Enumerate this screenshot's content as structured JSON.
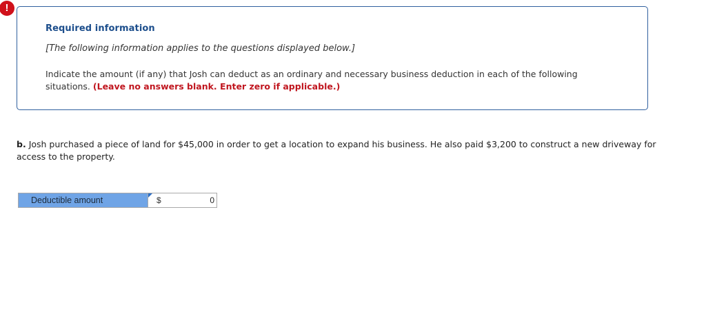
{
  "info_box": {
    "alert_symbol": "!",
    "title": "Required information",
    "note": "[The following information applies to the questions displayed below.]",
    "instructions": "Indicate the amount (if any) that Josh can deduct as an ordinary and necessary business deduction in each of the following situations.",
    "instructions_emphasis": "(Leave no answers blank. Enter zero if applicable.)"
  },
  "question": {
    "label": "b.",
    "text": "Josh purchased a piece of land for $45,000 in order to get a location to expand his business. He also paid $3,200 to construct a new driveway for access to the property."
  },
  "answer": {
    "row_label": "Deductible amount",
    "currency_symbol": "$",
    "value": "0"
  },
  "colors": {
    "alert": "#d0111b",
    "title": "#1c4e8c",
    "emphasis": "#c0161f",
    "label_cell": "#6fa4e6",
    "box_border": "#2f5f9e"
  }
}
